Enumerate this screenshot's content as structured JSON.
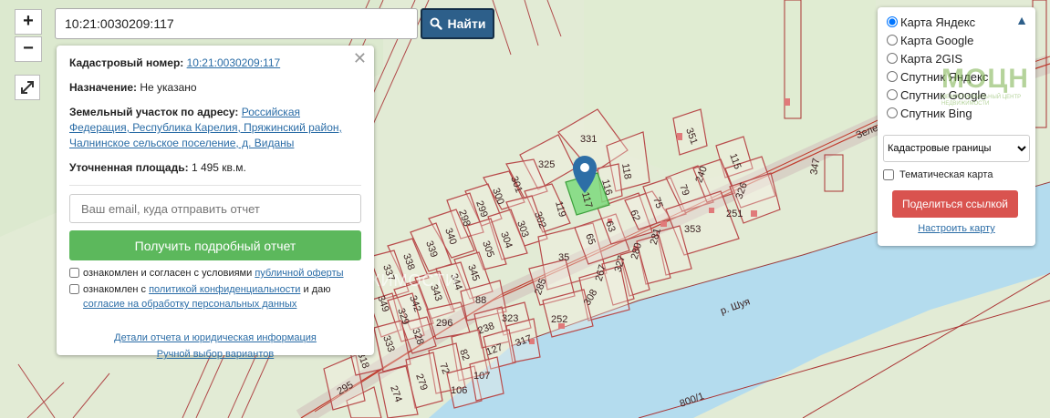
{
  "search": {
    "value": "10:21:0030209:117",
    "button_label": "Найти"
  },
  "zoom": {
    "in_label": "+",
    "out_label": "−"
  },
  "info": {
    "cadastral_label": "Кадастровый номер:",
    "cadastral_value": "10:21:0030209:117",
    "purpose_label": "Назначение:",
    "purpose_value": "Не указано",
    "address_label": "Земельный участок по адресу:",
    "address_value": "Российская Федерация, Республика Карелия, Пряжинский район, Чалнинское сельское поселение, д. Виданы",
    "area_label": "Уточненная площадь:",
    "area_value": "1 495 кв.м.",
    "email_placeholder": "Ваш email, куда отправить отчет",
    "report_button": "Получить подробный отчет",
    "consent1_prefix": "ознакомлен и согласен с условиями",
    "consent1_link": "публичной оферты",
    "consent2_prefix": "ознакомлен с",
    "consent2_link": "политикой конфиденциальности",
    "consent2_mid": "и даю",
    "consent2_link2": "согласие на обработку персональных данных",
    "details_link": "Детали отчета и юридическая информация",
    "manual_link": "Ручной выбор вариантов"
  },
  "map_panel": {
    "options": [
      "Карта Яндекс",
      "Карта Google",
      "Карта 2GIS",
      "Спутник Яндекс",
      "Спутник Google",
      "Спутник Bing"
    ],
    "selected": "Карта Яндекс",
    "layer_select": "Кадастровые границы",
    "thematic_label": "Тематическая карта",
    "share_button": "Поделиться ссылкой",
    "settings_link": "Настроить карту"
  },
  "logo": {
    "text": "МОЦН",
    "subtitle": "МЕЖРЕГИОНАЛЬНЫЙ ЦЕНТР НЕДВИЖИМОСТИ"
  },
  "watermark": "ЖИМОСТИ",
  "map_labels": {
    "river": "р. Шуя",
    "street": "Зелен",
    "p331": "331",
    "p325": "325",
    "p118": "118",
    "p116": "116",
    "p117": "117",
    "p119": "119",
    "p351": "351",
    "p115": "115",
    "p347": "347",
    "p301": "301",
    "p300": "300",
    "p299": "299",
    "p298": "298",
    "p302": "302",
    "p303": "303",
    "p304": "304",
    "p305": "305",
    "p340": "340",
    "p339": "339",
    "p338": "338",
    "p337": "337",
    "p345": "345",
    "p344": "344",
    "p343": "343",
    "p342": "342",
    "p349": "349",
    "p329": "329",
    "p328": "328",
    "p333": "333",
    "p296": "296",
    "p88": "88",
    "p35": "35",
    "p65": "65",
    "p63": "63",
    "p62": "62",
    "p75": "75",
    "p79": "79",
    "p240": "240",
    "p326": "326",
    "p251": "251",
    "p353": "353",
    "p281": "281",
    "p280": "280",
    "p327": "327",
    "p267": "267",
    "p308": "308",
    "p285": "285",
    "p252": "252",
    "p323": "323",
    "p238": "238",
    "p317": "317",
    "p127": "127",
    "p82": "82",
    "p72": "72",
    "p106": "106",
    "p107": "107",
    "p279": "279",
    "p274": "274",
    "p295": "295",
    "p318": "318",
    "p800_1": "800/1"
  }
}
